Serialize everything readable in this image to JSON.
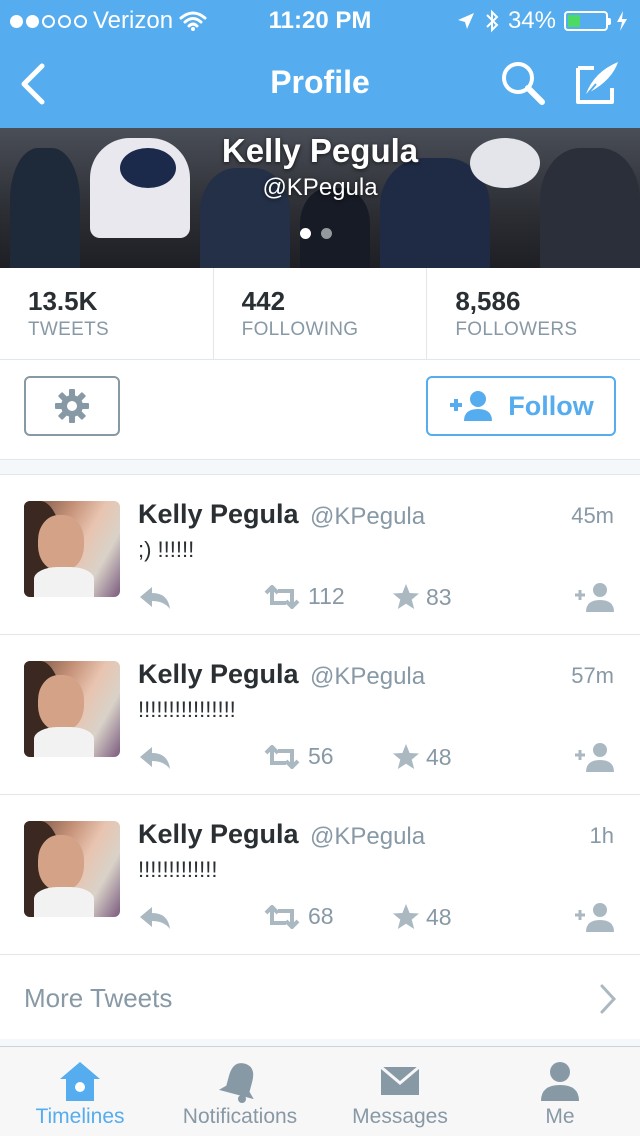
{
  "status_bar": {
    "carrier": "Verizon",
    "time": "11:20 PM",
    "battery": "34%",
    "battery_level": 0.34,
    "signal_dots_filled": 2,
    "signal_dots_total": 5
  },
  "nav": {
    "title": "Profile",
    "back_icon": "back-chevron-icon",
    "search_icon": "search-icon",
    "compose_icon": "compose-icon"
  },
  "profile": {
    "name": "Kelly Pegula",
    "handle": "@KPegula"
  },
  "stats": [
    {
      "value": "13.5K",
      "label": "TWEETS"
    },
    {
      "value": "442",
      "label": "FOLLOWING"
    },
    {
      "value": "8,586",
      "label": "FOLLOWERS"
    }
  ],
  "actions": {
    "settings_icon": "gear-icon",
    "follow_label": "Follow"
  },
  "tweets": [
    {
      "name": "Kelly Pegula",
      "handle": "@KPegula",
      "time": "45m",
      "text": ";) !!!!!!",
      "retweets": "112",
      "favorites": "83"
    },
    {
      "name": "Kelly Pegula",
      "handle": "@KPegula",
      "time": "57m",
      "text": "!!!!!!!!!!!!!!!!",
      "retweets": "56",
      "favorites": "48"
    },
    {
      "name": "Kelly Pegula",
      "handle": "@KPegula",
      "time": "1h",
      "text": "!!!!!!!!!!!!!",
      "retweets": "68",
      "favorites": "48"
    }
  ],
  "more_tweets": "More Tweets",
  "tabbar": [
    {
      "label": "Timelines",
      "icon": "home-icon",
      "active": true
    },
    {
      "label": "Notifications",
      "icon": "bell-icon",
      "active": false
    },
    {
      "label": "Messages",
      "icon": "envelope-icon",
      "active": false
    },
    {
      "label": "Me",
      "icon": "person-icon",
      "active": false
    }
  ],
  "colors": {
    "accent": "#55acee",
    "muted": "#8899a6",
    "text": "#292f33",
    "battery_green": "#4cd964"
  }
}
